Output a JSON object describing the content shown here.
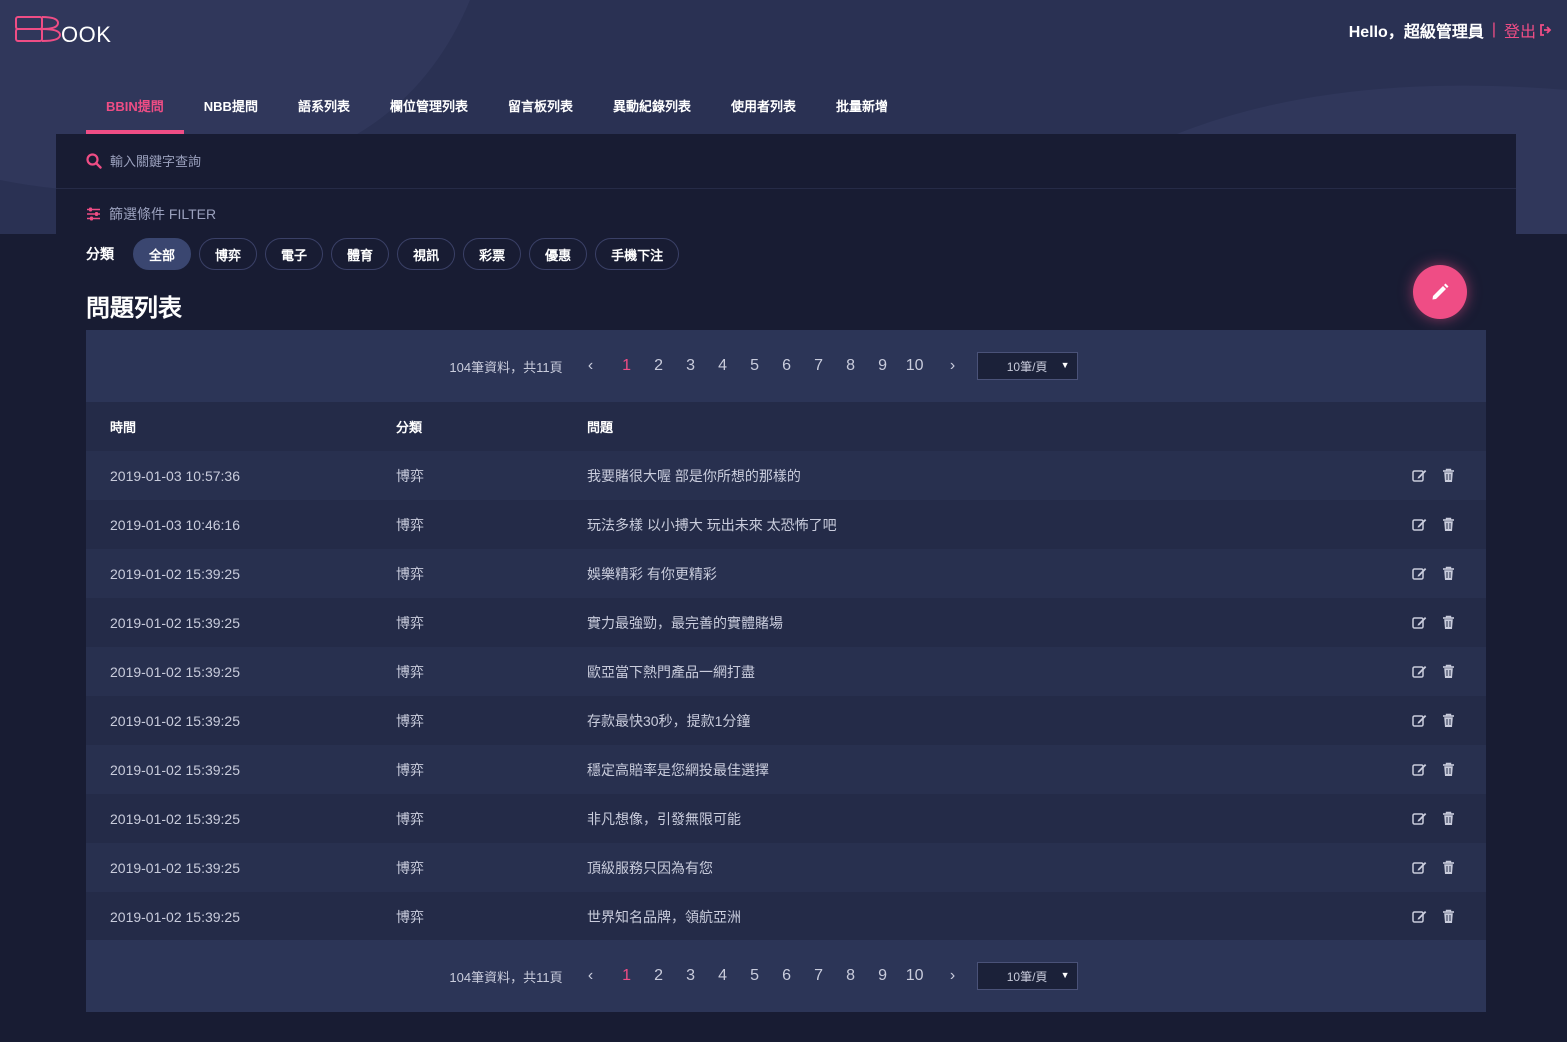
{
  "brand": {
    "logo_text": "OOK",
    "accent": "#ef4d85"
  },
  "header": {
    "greeting": "Hello，超級管理員",
    "separator": "|",
    "logout_label": "登出"
  },
  "nav": {
    "items": [
      {
        "label": "BBIN提問",
        "active": true
      },
      {
        "label": "NBB提問",
        "active": false
      },
      {
        "label": "語系列表",
        "active": false
      },
      {
        "label": "欄位管理列表",
        "active": false
      },
      {
        "label": "留言板列表",
        "active": false
      },
      {
        "label": "異動紀錄列表",
        "active": false
      },
      {
        "label": "使用者列表",
        "active": false
      },
      {
        "label": "批量新增",
        "active": false
      }
    ]
  },
  "search": {
    "placeholder": "輸入關鍵字查詢",
    "value": ""
  },
  "filter": {
    "title": "篩選條件 FILTER",
    "category_label": "分類",
    "chips": [
      {
        "label": "全部",
        "active": true
      },
      {
        "label": "博弈",
        "active": false
      },
      {
        "label": "電子",
        "active": false
      },
      {
        "label": "體育",
        "active": false
      },
      {
        "label": "視訊",
        "active": false
      },
      {
        "label": "彩票",
        "active": false
      },
      {
        "label": "優惠",
        "active": false
      },
      {
        "label": "手機下注",
        "active": false
      }
    ]
  },
  "list": {
    "title": "問題列表",
    "pager": {
      "info": "104筆資料，共11頁",
      "prev": "‹",
      "next": "›",
      "pages": [
        "1",
        "2",
        "3",
        "4",
        "5",
        "6",
        "7",
        "8",
        "9",
        "10"
      ],
      "current": "1",
      "per_page": "10筆/頁"
    },
    "columns": {
      "time": "時間",
      "category": "分類",
      "question": "問題"
    },
    "rows": [
      {
        "time": "2019-01-03 10:57:36",
        "category": "博弈",
        "question": "我要賭很大喔 部是你所想的那樣的"
      },
      {
        "time": "2019-01-03 10:46:16",
        "category": "博弈",
        "question": "玩法多樣 以小搏大 玩出未來 太恐怖了吧"
      },
      {
        "time": "2019-01-02 15:39:25",
        "category": "博弈",
        "question": "娛樂精彩 有你更精彩"
      },
      {
        "time": "2019-01-02 15:39:25",
        "category": "博弈",
        "question": "實力最強勁，最完善的實體賭場"
      },
      {
        "time": "2019-01-02 15:39:25",
        "category": "博弈",
        "question": "歐亞當下熱門產品一網打盡"
      },
      {
        "time": "2019-01-02 15:39:25",
        "category": "博弈",
        "question": "存款最快30秒，提款1分鐘"
      },
      {
        "time": "2019-01-02 15:39:25",
        "category": "博弈",
        "question": "穩定高賠率是您網投最佳選擇"
      },
      {
        "time": "2019-01-02 15:39:25",
        "category": "博弈",
        "question": "非凡想像，引發無限可能"
      },
      {
        "time": "2019-01-02 15:39:25",
        "category": "博弈",
        "question": "頂級服務只因為有您"
      },
      {
        "time": "2019-01-02 15:39:25",
        "category": "博弈",
        "question": "世界知名品牌，領航亞洲"
      }
    ]
  },
  "icons": {
    "search": "search-icon",
    "filter": "sliders-icon",
    "edit": "edit-icon",
    "delete": "trash-icon",
    "fab": "pencil-icon",
    "logout": "sign-out-icon"
  }
}
